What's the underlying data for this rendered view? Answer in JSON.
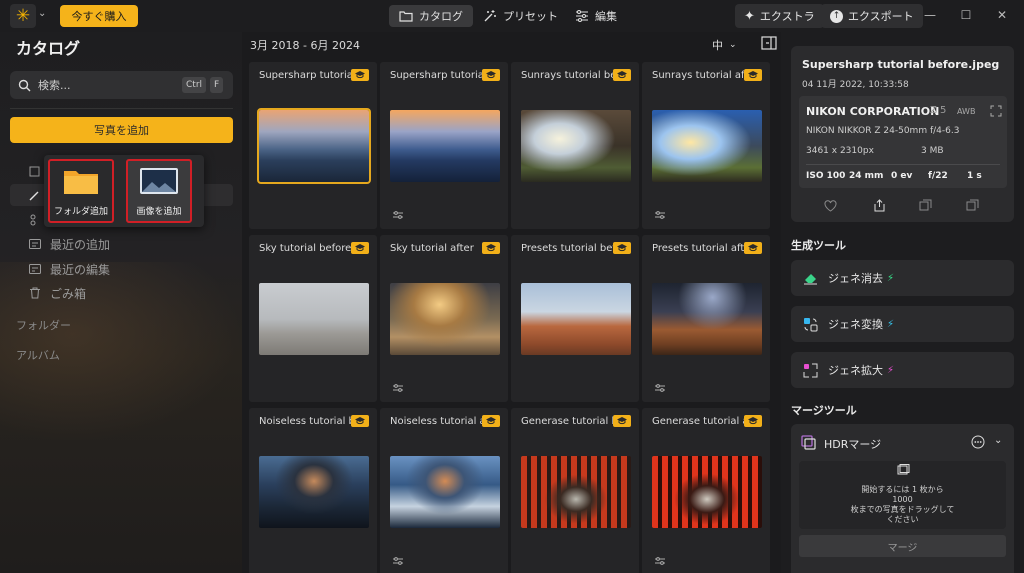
{
  "topbar": {
    "logo_icon": "sun-logo-icon",
    "buy_label": "今すぐ購入",
    "tabs": [
      {
        "label": "カタログ",
        "icon": "folder-icon"
      },
      {
        "label": "プリセット",
        "icon": "magic-wand-icon"
      },
      {
        "label": "編集",
        "icon": "sliders-icon"
      }
    ],
    "extra_label": "エクストラ",
    "export_label": "エクスポート"
  },
  "sidebar": {
    "title": "カタログ",
    "search_placeholder": "検索...",
    "shortcut_ctrl": "Ctrl",
    "shortcut_f": "F",
    "add_photos_label": "写真を追加",
    "popup": {
      "add_folder": "フォルダ追加",
      "add_image": "画像を追加"
    },
    "nav": [
      {
        "label": "最近の追加"
      },
      {
        "label": "最近の編集"
      },
      {
        "label": "ごみ箱"
      }
    ],
    "folders_label": "フォルダー",
    "albums_label": "アルバム"
  },
  "grid": {
    "date_range": "3月 2018 - 6月 2024",
    "size_label": "中",
    "items": [
      {
        "title": "Supersharp tutorial before.jpeg",
        "selected": true
      },
      {
        "title": "Supersharp tutorial after.jpeg",
        "edited": true
      },
      {
        "title": "Sunrays tutorial before.jpeg"
      },
      {
        "title": "Sunrays tutorial after.jpeg",
        "edited": true
      },
      {
        "title": "Sky tutorial before"
      },
      {
        "title": "Sky tutorial after",
        "edited": true
      },
      {
        "title": "Presets tutorial before.jpeg"
      },
      {
        "title": "Presets tutorial after.jpeg",
        "edited": true
      },
      {
        "title": "Noiseless tutorial before.jpeg"
      },
      {
        "title": "Noiseless tutorial after.jpeg",
        "edited": true
      },
      {
        "title": "Generase tutorial before.jpeg"
      },
      {
        "title": "Generase tutorial after.jpeg",
        "edited": true
      }
    ]
  },
  "info": {
    "filename": "Supersharp tutorial before.jpeg",
    "datetime": "04 11月 2022, 10:33:58",
    "brand": "NIKON CORPORATION",
    "model": "Z 5",
    "wb": "AWB",
    "lens": "NIKON NIKKOR Z 24-50mm f/4-6.3",
    "resolution": "3461 x 2310px",
    "filesize": "3 MB",
    "iso": "ISO 100",
    "focal": "24 mm",
    "ev": "0 ev",
    "aperture": "f/22",
    "shutter": "1 s"
  },
  "gen_tools": {
    "heading": "生成ツール",
    "items": [
      {
        "label": "ジェネ消去",
        "icon": "eraser-icon",
        "bolt_color": "#37e08a"
      },
      {
        "label": "ジェネ変換",
        "icon": "swap-icon",
        "bolt_color": "#37c7f0"
      },
      {
        "label": "ジェネ拡大",
        "icon": "expand-icon",
        "bolt_color": "#e84fd1"
      }
    ]
  },
  "merge_tools": {
    "heading": "マージツール",
    "hdr_label": "HDRマージ",
    "drop_text_1": "開始するには 1 枚から",
    "drop_text_2": "1000",
    "drop_text_3": "枚までの写真をドラッグして",
    "drop_text_4": "ください",
    "merge_button": "マージ"
  },
  "colors": {
    "accent": "#f5b31a",
    "highlight_border": "#d11f26"
  }
}
